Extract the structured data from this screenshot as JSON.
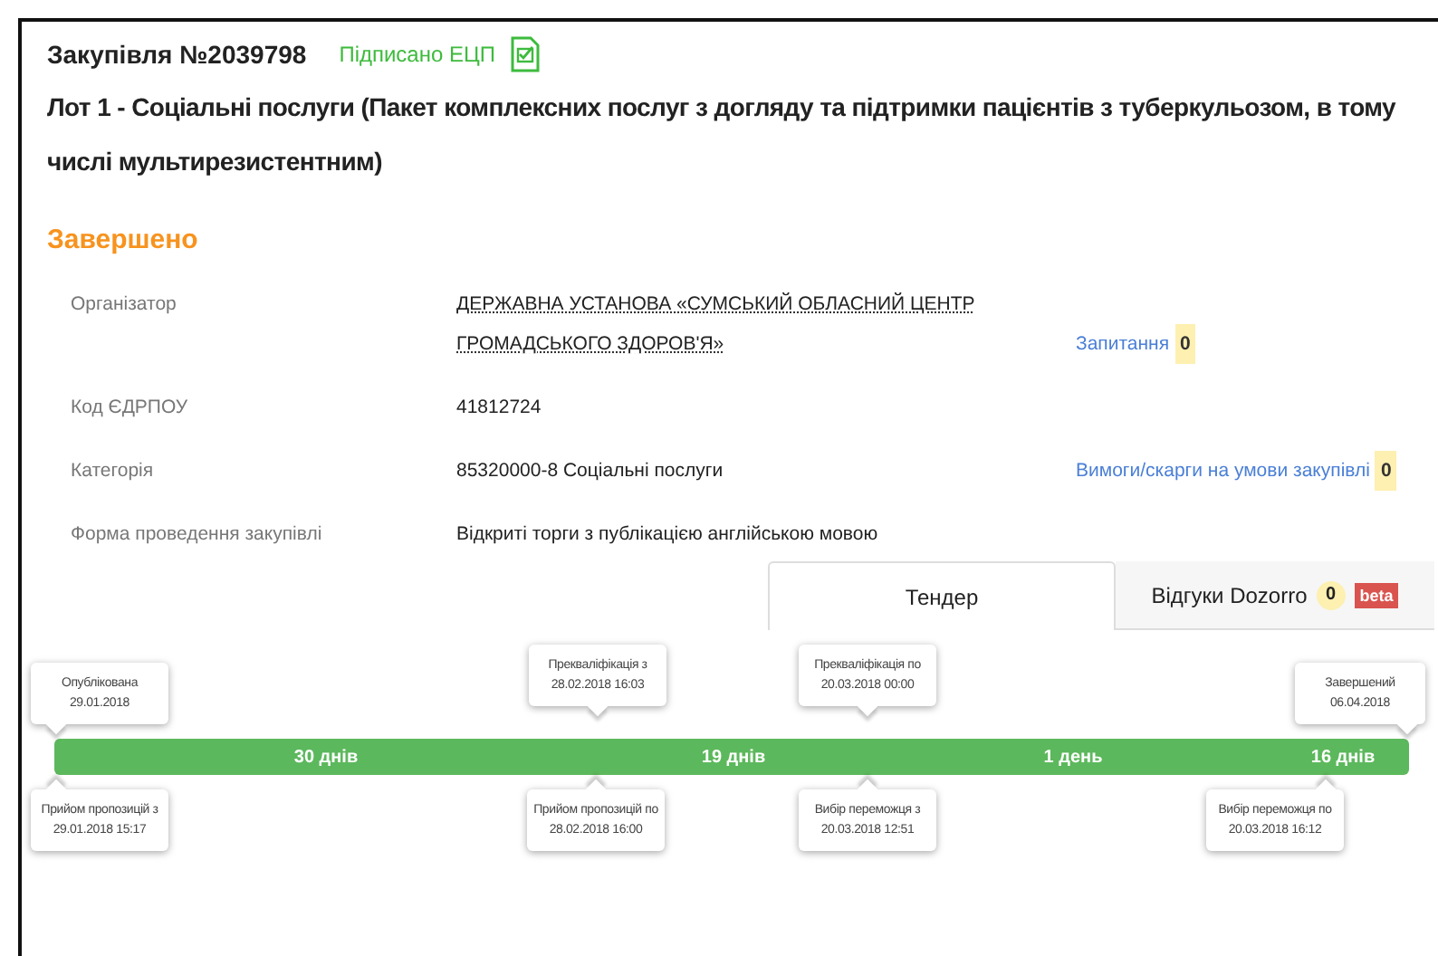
{
  "header": {
    "title": "Закупівля №2039798",
    "signature": "Підписано ЕЦП"
  },
  "lot_title": "Лот 1 - Соціальні послуги (Пакет комплексних послуг з догляду та підтримки пацієнтів з туберкульозом, в тому числі мультирезистентним)",
  "status": "Завершено",
  "details": [
    {
      "label": "Організатор",
      "value": "ДЕРЖАВНА УСТАНОВА «СУМСЬКИЙ ОБЛАСНИЙ ЦЕНТР ГРОМАДСЬКОГО ЗДОРОВ'Я»",
      "kind": "link",
      "side": {
        "label": "Запитання",
        "count": "0"
      }
    },
    {
      "label": "Код ЄДРПОУ",
      "value": "41812724",
      "kind": "text"
    },
    {
      "label": "Категорія",
      "value": "85320000-8 Соціальні послуги",
      "kind": "text",
      "side": {
        "label": "Вимоги/скарги на умови закупівлі",
        "count": "0"
      }
    },
    {
      "label": "Форма проведення закупівлі",
      "value": "Відкриті торги з публікацією англійською мовою",
      "kind": "text"
    }
  ],
  "tabs": [
    {
      "label": "Тендер",
      "selected": true
    },
    {
      "label": "Відгуки Dozorro",
      "count": "0",
      "badge": "beta",
      "selected": false
    }
  ],
  "timeline": {
    "top": [
      {
        "title": "Опублікована",
        "date": "29.01.2018"
      },
      {
        "title": "Прекваліфікація з",
        "date": "28.02.2018 16:03"
      },
      {
        "title": "Прекваліфікація по",
        "date": "20.03.2018 00:00"
      },
      {
        "title": "Завершений",
        "date": "06.04.2018"
      }
    ],
    "segments": [
      "30 днів",
      "19 днів",
      "1 день",
      "16 днів"
    ],
    "bottom": [
      {
        "title": "Прийом пропозицій з",
        "date": "29.01.2018 15:17"
      },
      {
        "title": "Прийом пропозицій по",
        "date": "28.02.2018 16:00"
      },
      {
        "title": "Вибір переможця з",
        "date": "20.03.2018 12:51"
      },
      {
        "title": "Вибір переможця по",
        "date": "20.03.2018 16:12"
      }
    ]
  }
}
